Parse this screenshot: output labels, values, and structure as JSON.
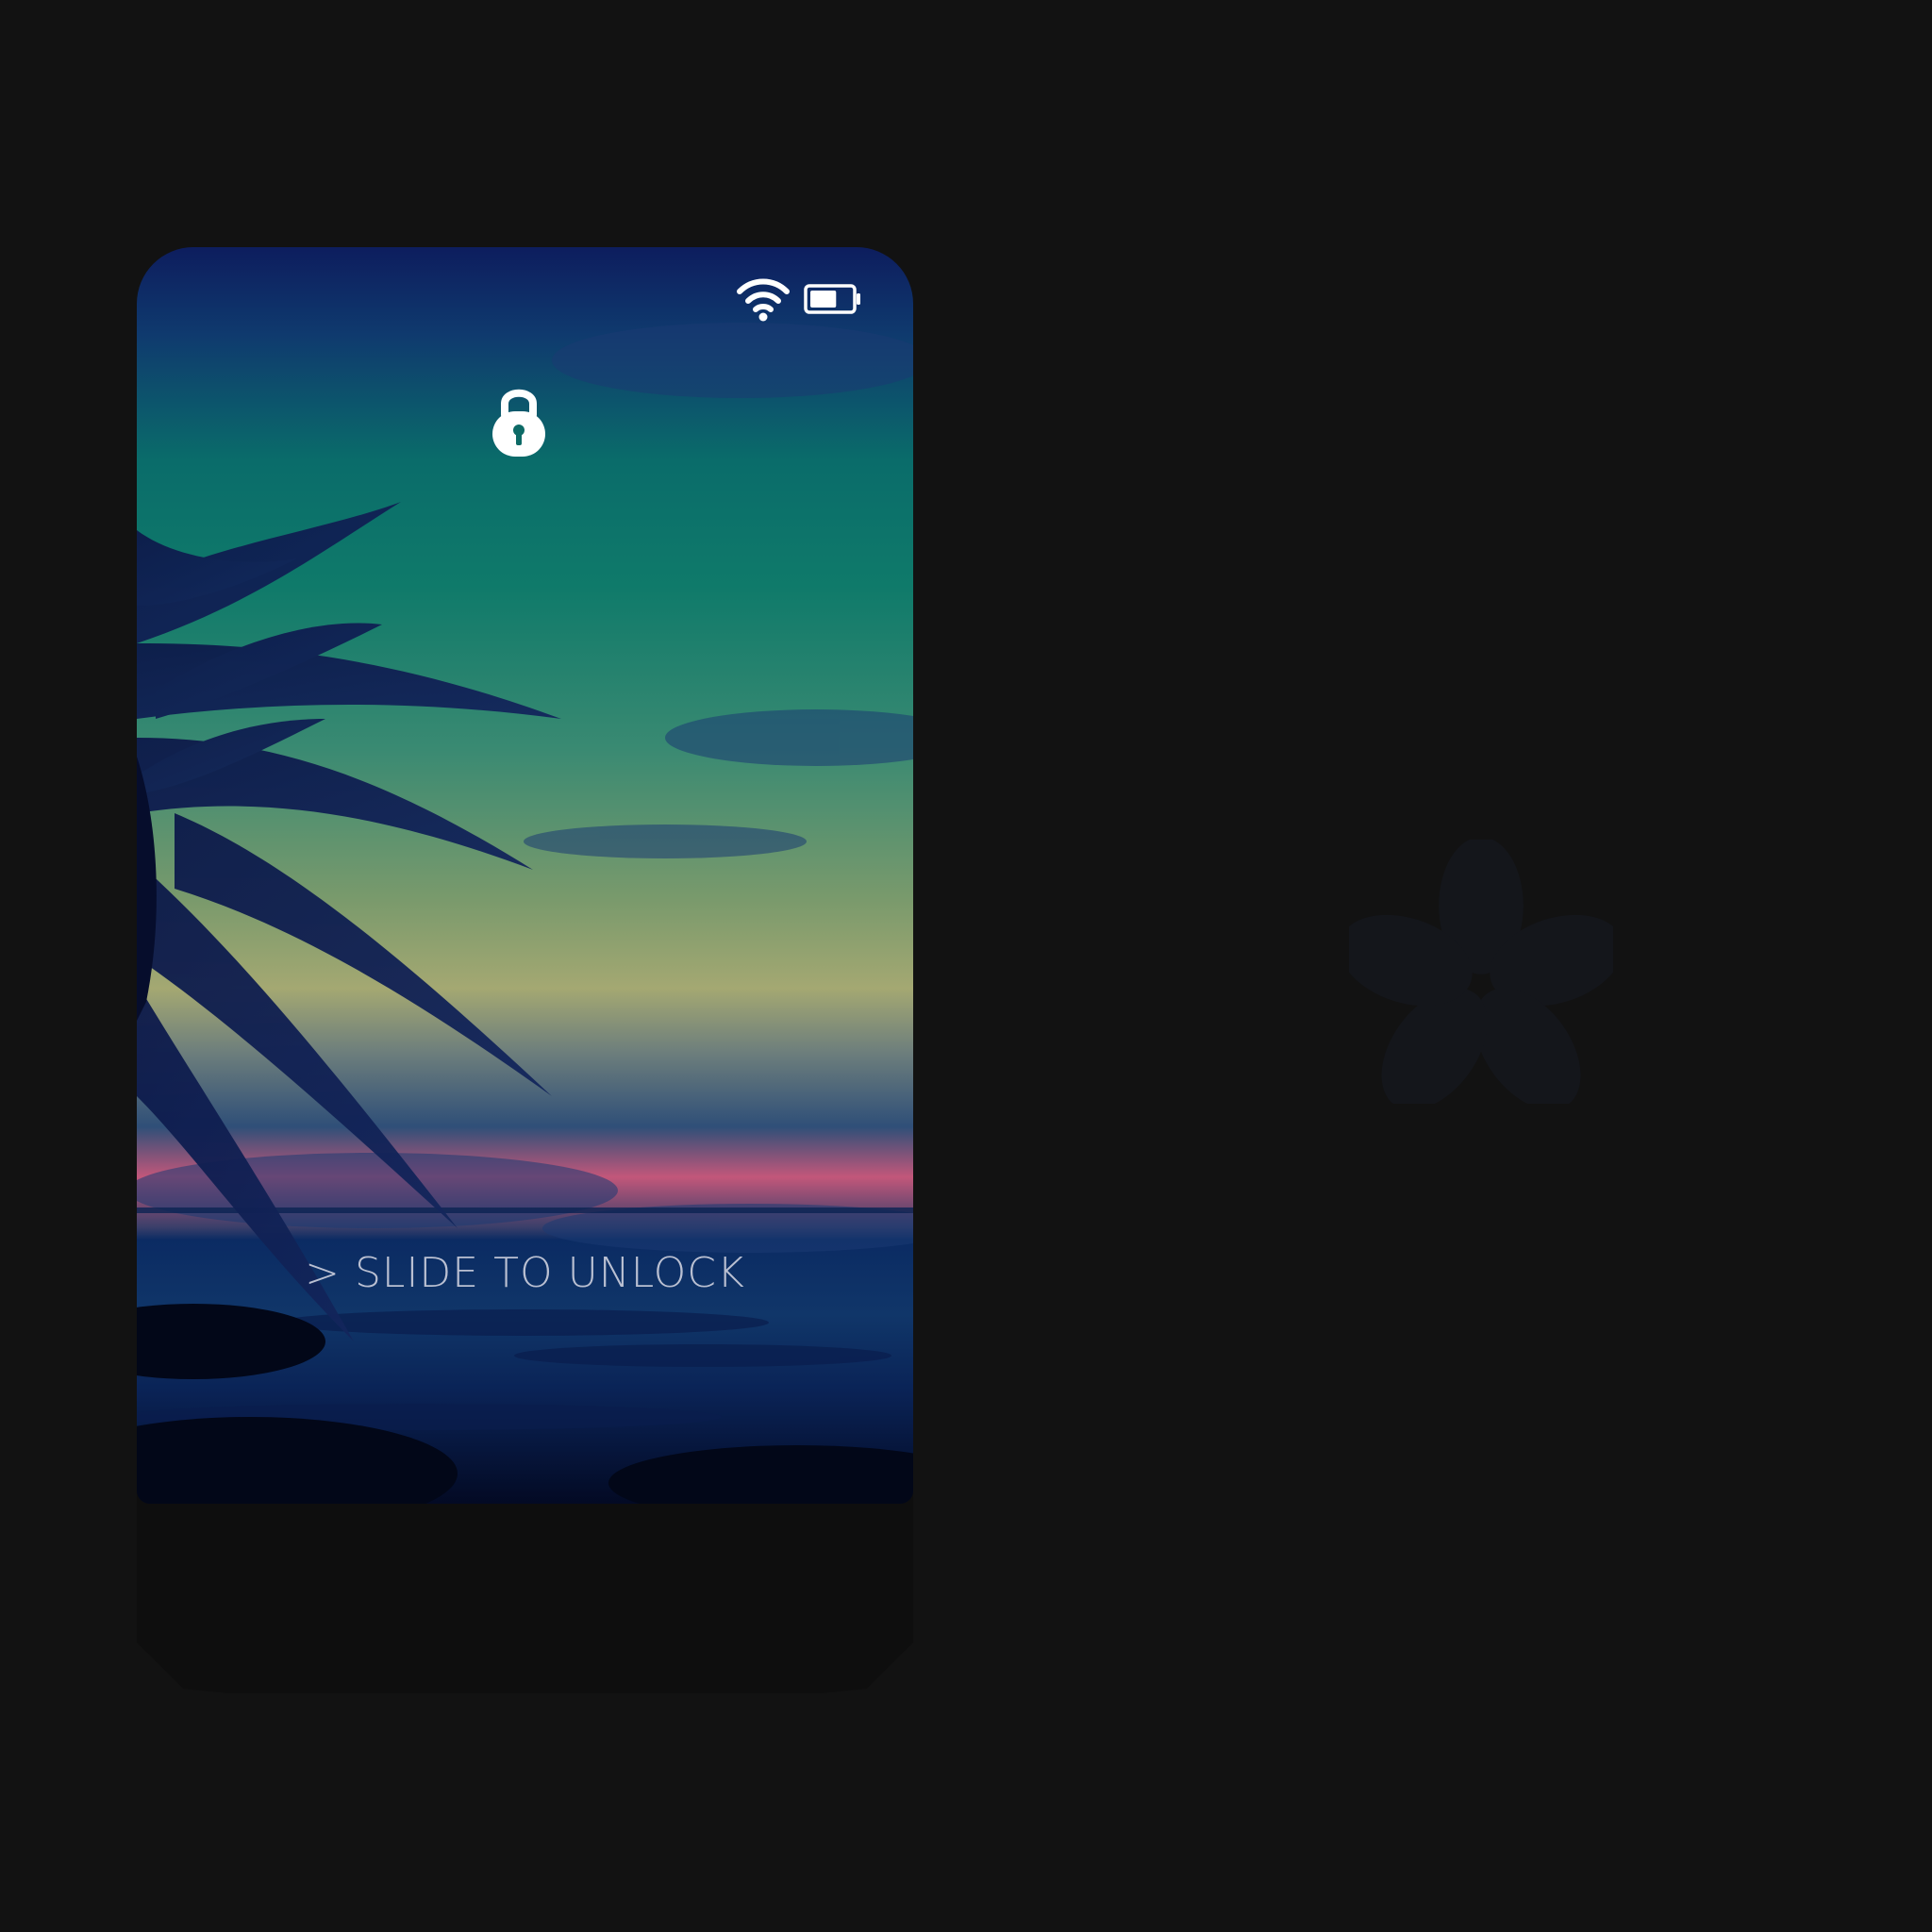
{
  "lockscreen": {
    "unlock_prompt": "> SLIDE TO UNLOCK",
    "status_icons": [
      "wifi-icon",
      "battery-icon"
    ],
    "lock_icon": "lock-icon",
    "battery_level": 0.65
  },
  "decor": {
    "watermark_icon": "flower-icon"
  },
  "colors": {
    "background": "#121212",
    "icon": "#ffffff",
    "text": "#c9cddc",
    "sky_top": "#0d1d5e",
    "sky_mid": "#0f7a6a",
    "horizon_pink": "#c2577a",
    "sea": "#0b2b63"
  }
}
